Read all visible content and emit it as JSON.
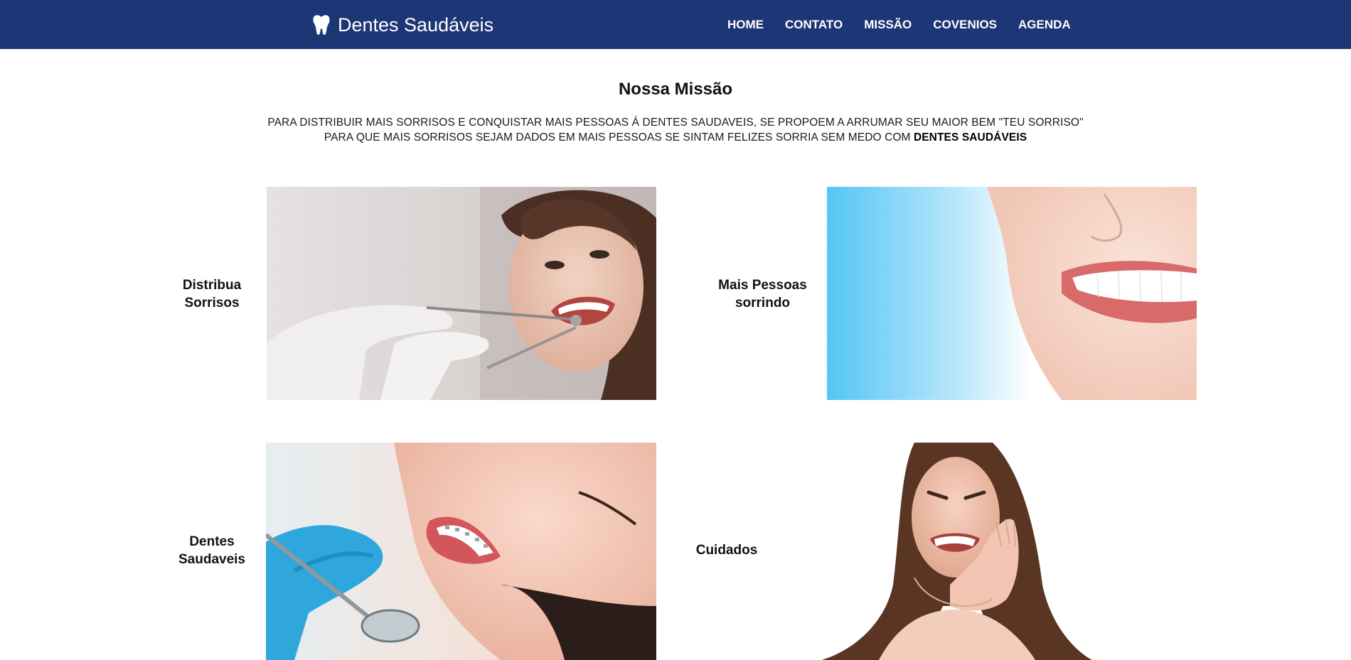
{
  "brand": {
    "name": "Dentes Saudáveis",
    "icon": "tooth-icon"
  },
  "nav": {
    "items": [
      {
        "label": "HOME"
      },
      {
        "label": "CONTATO"
      },
      {
        "label": "MISSÃO"
      },
      {
        "label": "COVENIOS"
      },
      {
        "label": "AGENDA"
      }
    ]
  },
  "mission": {
    "title": "Nossa Missão",
    "line1": "PARA DISTRIBUIR MAIS SORRISOS E CONQUISTAR MAIS PESSOAS Á DENTES SAUDAVEIS, SE PROPOEM A ARRUMAR SEU MAIOR BEM \"TEU SORRISO\"",
    "line2_prefix": "PARA QUE MAIS SORRISOS SEJAM DADOS EM MAIS PESSOAS SE SINTAM FELIZES SORRIA SEM MEDO COM ",
    "line2_emphasis": "DENTES SAUDÁVEIS"
  },
  "features": [
    {
      "line1": "Distribua",
      "line2": "Sorrisos"
    },
    {
      "line1": "Mais Pessoas",
      "line2": "sorrindo"
    },
    {
      "line1": "Dentes",
      "line2": "Saudaveis"
    },
    {
      "line1": "Cuidados",
      "line2": ""
    }
  ],
  "colors": {
    "navbar": "#1d3675",
    "nav_text": "#ffffff"
  }
}
